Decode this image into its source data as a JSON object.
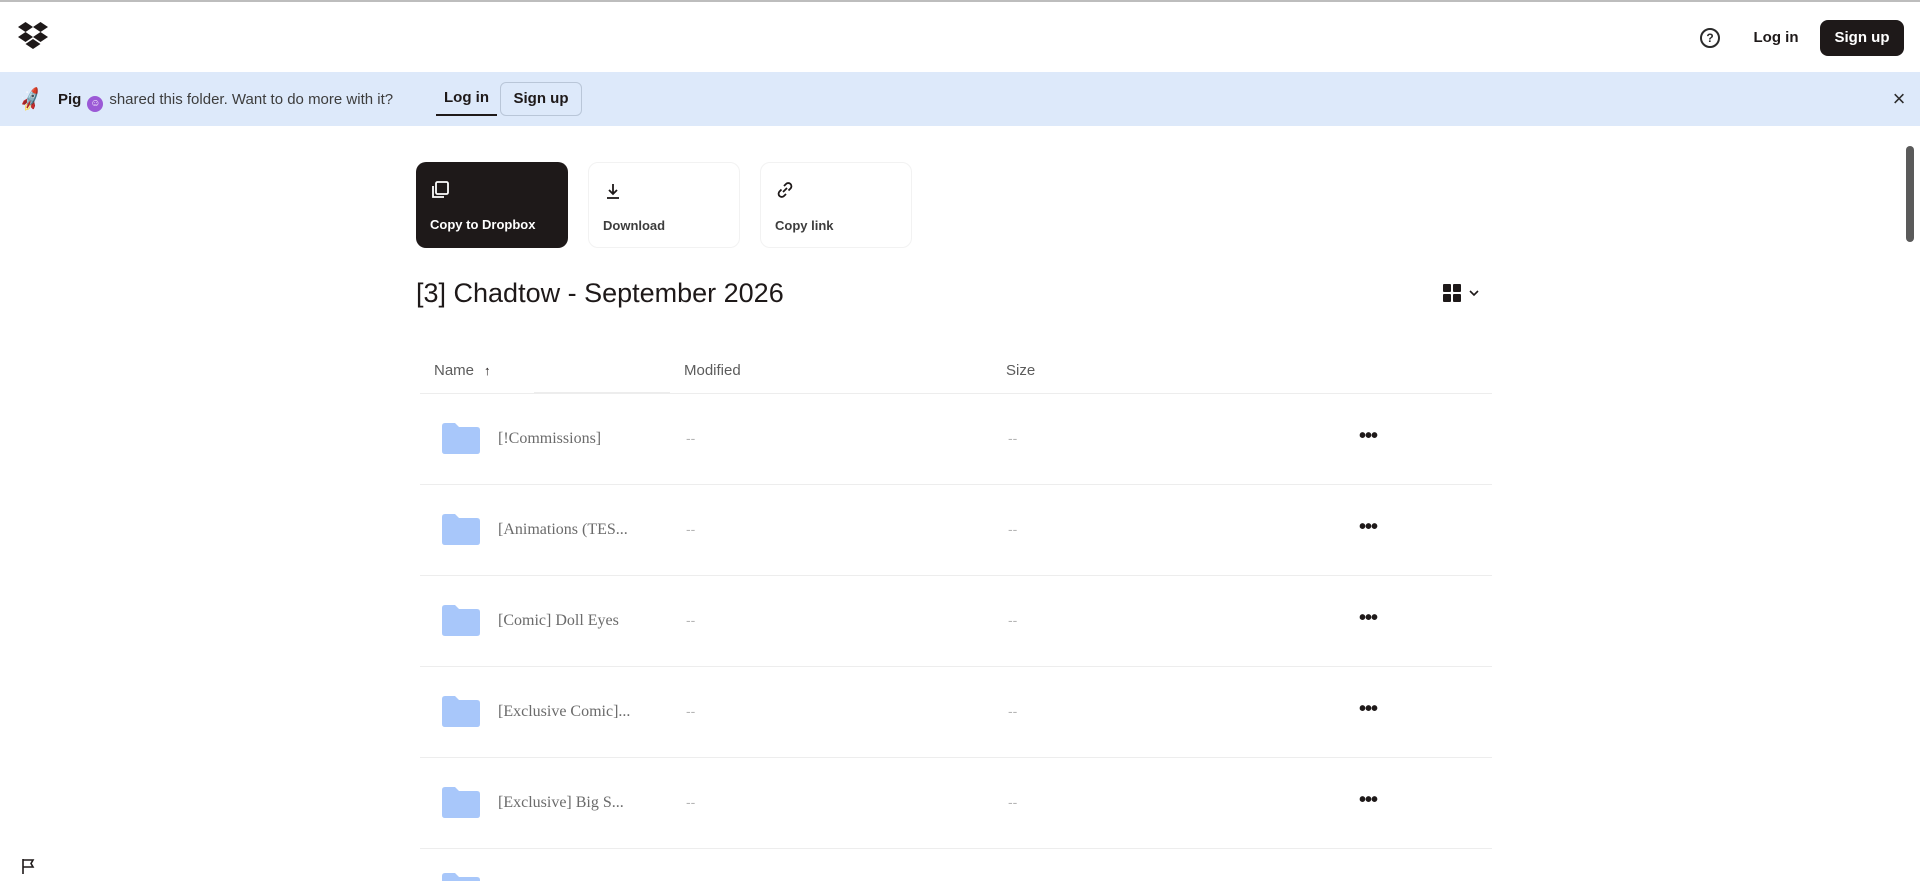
{
  "header": {
    "help_icon": "?",
    "login_label": "Log in",
    "signup_label": "Sign up"
  },
  "banner": {
    "owner": "Pig",
    "owner_badge": "☺",
    "message": "shared this folder. Want to do more with it?",
    "login_label": "Log in",
    "signup_label": "Sign up",
    "close_icon": "×"
  },
  "actions": {
    "copy_label": "Copy to Dropbox",
    "download_label": "Download",
    "copy_link_label": "Copy link"
  },
  "folder": {
    "title": "[3] Chadtow - September 2026"
  },
  "table": {
    "columns": {
      "name": "Name",
      "modified": "Modified",
      "size": "Size",
      "sort_arrow": "↑"
    },
    "rows": [
      {
        "name": "[!Commissions]",
        "modified": "--",
        "size": "--",
        "more": "•••"
      },
      {
        "name": "[Animations (TES...",
        "modified": "--",
        "size": "--",
        "more": "•••"
      },
      {
        "name": "[Comic] Doll Eyes",
        "modified": "--",
        "size": "--",
        "more": "•••"
      },
      {
        "name": "[Exclusive Comic]...",
        "modified": "--",
        "size": "--",
        "more": "•••"
      },
      {
        "name": "[Exclusive] Big S...",
        "modified": "--",
        "size": "--",
        "more": "•••"
      }
    ]
  },
  "colors": {
    "brand_dark": "#1e1919",
    "banner_bg": "#dde9fa",
    "folder_blue": "#a8c7fa"
  }
}
